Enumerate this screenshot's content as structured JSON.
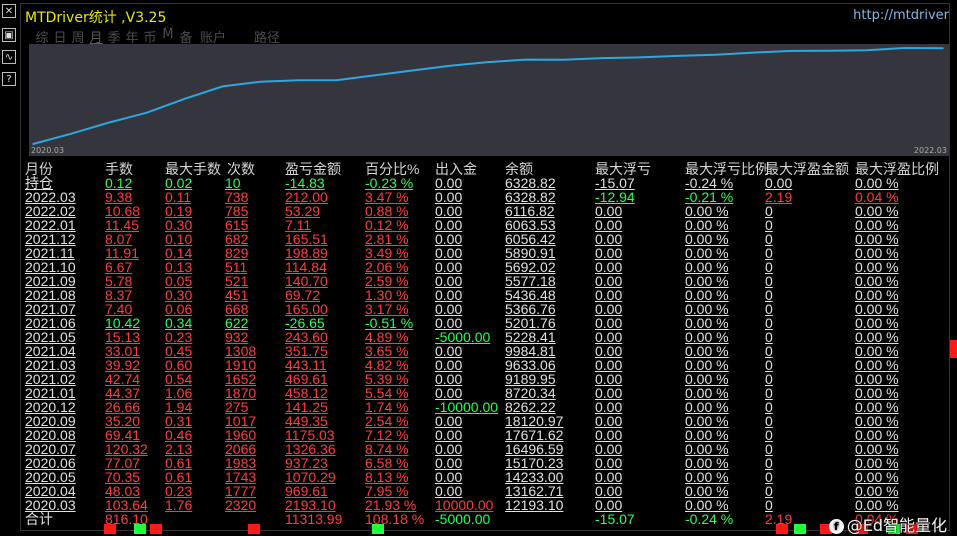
{
  "window": {
    "title": "MTDriver统计 ,V3.25",
    "url_text": "http://mtdriver"
  },
  "tabs": [
    {
      "label": "综",
      "active": false
    },
    {
      "label": "日",
      "active": false
    },
    {
      "label": "周",
      "active": false
    },
    {
      "label": "月",
      "active": true
    },
    {
      "label": "季",
      "active": false
    },
    {
      "label": "年",
      "active": false
    },
    {
      "label": "币",
      "active": false
    },
    {
      "label": "M",
      "active": false
    },
    {
      "label": "备",
      "active": false
    },
    {
      "label": "账户",
      "active": false
    },
    {
      "label": "路径",
      "active": false
    }
  ],
  "chart_data": {
    "type": "line",
    "x_start_label": "2020.03",
    "x_end_label": "2022.03",
    "x": [
      "2020.03",
      "2020.04",
      "2020.05",
      "2020.06",
      "2020.07",
      "2020.08",
      "2020.09",
      "2020.10",
      "2020.12",
      "2021.01",
      "2021.02",
      "2021.03",
      "2021.04",
      "2021.05",
      "2021.06",
      "2021.07",
      "2021.08",
      "2021.09",
      "2021.10",
      "2021.11",
      "2021.12",
      "2022.01",
      "2022.02",
      "2022.03",
      "持仓"
    ],
    "series": [
      {
        "values": [
          0,
          969.61,
          2039.9,
          2977.13,
          4303.49,
          5478.8,
          5928.15,
          6069.4,
          6069.4,
          6527.52,
          6997.13,
          7440.24,
          7791.99,
          8035.59,
          8008.94,
          8173.94,
          8243.66,
          8384.36,
          8499.2,
          8698.09,
          8863.6,
          8870.71,
          8924,
          9136,
          9121.17
        ]
      }
    ],
    "line_color": "#2aa9e0",
    "grid": false
  },
  "columns": [
    "月份",
    "手数",
    "最大手数",
    "次数",
    "盈亏金额",
    "百分比%",
    "出入金",
    "余额",
    "最大浮亏",
    "最大浮亏比例",
    "最大浮盈金额",
    "最大浮盈比例"
  ],
  "rows": [
    {
      "month": "持仓",
      "lots": "0.12",
      "maxlots": "0.02",
      "count": "10",
      "pnl": "-14.83",
      "pct": "-0.23 %",
      "io": "0.00",
      "bal": "6328.82",
      "fl": "-15.07",
      "flp": "-0.24 %",
      "fp": "0.00",
      "fpp": "0.00 %",
      "tone": "green"
    },
    {
      "month": "2022.03",
      "lots": "9.38",
      "maxlots": "0.11",
      "count": "738",
      "pnl": "212.00",
      "pct": "3.47 %",
      "io": "0.00",
      "bal": "6328.82",
      "fl": "-12.94",
      "flp": "-0.21 %",
      "fp": "2.19",
      "fpp": "0.04 %",
      "tone": "red",
      "flgreen": true,
      "fpred": true
    },
    {
      "month": "2022.02",
      "lots": "10.68",
      "maxlots": "0.19",
      "count": "785",
      "pnl": "53.29",
      "pct": "0.88 %",
      "io": "0.00",
      "bal": "6116.82",
      "fl": "0.00",
      "flp": "0.00 %",
      "fp": "0",
      "fpp": "0.00 %",
      "tone": "red"
    },
    {
      "month": "2022.01",
      "lots": "11.45",
      "maxlots": "0.30",
      "count": "615",
      "pnl": "7.11",
      "pct": "0.12 %",
      "io": "0.00",
      "bal": "6063.53",
      "fl": "0.00",
      "flp": "0.00 %",
      "fp": "0",
      "fpp": "0.00 %",
      "tone": "red"
    },
    {
      "month": "2021.12",
      "lots": "8.07",
      "maxlots": "0.10",
      "count": "682",
      "pnl": "165.51",
      "pct": "2.81 %",
      "io": "0.00",
      "bal": "6056.42",
      "fl": "0.00",
      "flp": "0.00 %",
      "fp": "0",
      "fpp": "0.00 %",
      "tone": "red"
    },
    {
      "month": "2021.11",
      "lots": "11.91",
      "maxlots": "0.14",
      "count": "829",
      "pnl": "198.89",
      "pct": "3.49 %",
      "io": "0.00",
      "bal": "5890.91",
      "fl": "0.00",
      "flp": "0.00 %",
      "fp": "0",
      "fpp": "0.00 %",
      "tone": "red"
    },
    {
      "month": "2021.10",
      "lots": "6.67",
      "maxlots": "0.13",
      "count": "511",
      "pnl": "114.84",
      "pct": "2.06 %",
      "io": "0.00",
      "bal": "5692.02",
      "fl": "0.00",
      "flp": "0.00 %",
      "fp": "0",
      "fpp": "0.00 %",
      "tone": "red"
    },
    {
      "month": "2021.09",
      "lots": "5.78",
      "maxlots": "0.05",
      "count": "521",
      "pnl": "140.70",
      "pct": "2.59 %",
      "io": "0.00",
      "bal": "5577.18",
      "fl": "0.00",
      "flp": "0.00 %",
      "fp": "0",
      "fpp": "0.00 %",
      "tone": "red"
    },
    {
      "month": "2021.08",
      "lots": "8.37",
      "maxlots": "0.30",
      "count": "451",
      "pnl": "69.72",
      "pct": "1.30 %",
      "io": "0.00",
      "bal": "5436.48",
      "fl": "0.00",
      "flp": "0.00 %",
      "fp": "0",
      "fpp": "0.00 %",
      "tone": "red"
    },
    {
      "month": "2021.07",
      "lots": "7.40",
      "maxlots": "0.06",
      "count": "668",
      "pnl": "165.00",
      "pct": "3.17 %",
      "io": "0.00",
      "bal": "5366.76",
      "fl": "0.00",
      "flp": "0.00 %",
      "fp": "0",
      "fpp": "0.00 %",
      "tone": "red"
    },
    {
      "month": "2021.06",
      "lots": "10.42",
      "maxlots": "0.34",
      "count": "622",
      "pnl": "-26.65",
      "pct": "-0.51 %",
      "io": "0.00",
      "bal": "5201.76",
      "fl": "0.00",
      "flp": "0.00 %",
      "fp": "0",
      "fpp": "0.00 %",
      "tone": "green"
    },
    {
      "month": "2021.05",
      "lots": "15.13",
      "maxlots": "0.23",
      "count": "932",
      "pnl": "243.60",
      "pct": "4.89 %",
      "io": "-5000.00",
      "bal": "5228.41",
      "fl": "0.00",
      "flp": "0.00 %",
      "fp": "0",
      "fpp": "0.00 %",
      "tone": "red",
      "iogreen": true
    },
    {
      "month": "2021.04",
      "lots": "33.01",
      "maxlots": "0.45",
      "count": "1308",
      "pnl": "351.75",
      "pct": "3.65 %",
      "io": "0.00",
      "bal": "9984.81",
      "fl": "0.00",
      "flp": "0.00 %",
      "fp": "0",
      "fpp": "0.00 %",
      "tone": "red"
    },
    {
      "month": "2021.03",
      "lots": "39.92",
      "maxlots": "0.60",
      "count": "1910",
      "pnl": "443.11",
      "pct": "4.82 %",
      "io": "0.00",
      "bal": "9633.06",
      "fl": "0.00",
      "flp": "0.00 %",
      "fp": "0",
      "fpp": "0.00 %",
      "tone": "red"
    },
    {
      "month": "2021.02",
      "lots": "42.74",
      "maxlots": "0.54",
      "count": "1652",
      "pnl": "469.61",
      "pct": "5.39 %",
      "io": "0.00",
      "bal": "9189.95",
      "fl": "0.00",
      "flp": "0.00 %",
      "fp": "0",
      "fpp": "0.00 %",
      "tone": "red"
    },
    {
      "month": "2021.01",
      "lots": "44.37",
      "maxlots": "1.06",
      "count": "1870",
      "pnl": "458.12",
      "pct": "5.54 %",
      "io": "0.00",
      "bal": "8720.34",
      "fl": "0.00",
      "flp": "0.00 %",
      "fp": "0",
      "fpp": "0.00 %",
      "tone": "red"
    },
    {
      "month": "2020.12",
      "lots": "26.66",
      "maxlots": "1.94",
      "count": "275",
      "pnl": "141.25",
      "pct": "1.74 %",
      "io": "-10000.00",
      "bal": "8262.22",
      "fl": "0.00",
      "flp": "0.00 %",
      "fp": "0",
      "fpp": "0.00 %",
      "tone": "red",
      "iogreen": true
    },
    {
      "month": "2020.09",
      "lots": "35.20",
      "maxlots": "0.31",
      "count": "1017",
      "pnl": "449.35",
      "pct": "2.54 %",
      "io": "0.00",
      "bal": "18120.97",
      "fl": "0.00",
      "flp": "0.00 %",
      "fp": "0",
      "fpp": "0.00 %",
      "tone": "red"
    },
    {
      "month": "2020.08",
      "lots": "69.41",
      "maxlots": "0.46",
      "count": "1960",
      "pnl": "1175.03",
      "pct": "7.12 %",
      "io": "0.00",
      "bal": "17671.62",
      "fl": "0.00",
      "flp": "0.00 %",
      "fp": "0",
      "fpp": "0.00 %",
      "tone": "red"
    },
    {
      "month": "2020.07",
      "lots": "120.32",
      "maxlots": "2.13",
      "count": "2066",
      "pnl": "1326.36",
      "pct": "8.74 %",
      "io": "0.00",
      "bal": "16496.59",
      "fl": "0.00",
      "flp": "0.00 %",
      "fp": "0",
      "fpp": "0.00 %",
      "tone": "red"
    },
    {
      "month": "2020.06",
      "lots": "77.07",
      "maxlots": "0.61",
      "count": "1983",
      "pnl": "937.23",
      "pct": "6.58 %",
      "io": "0.00",
      "bal": "15170.23",
      "fl": "0.00",
      "flp": "0.00 %",
      "fp": "0",
      "fpp": "0.00 %",
      "tone": "red"
    },
    {
      "month": "2020.05",
      "lots": "70.35",
      "maxlots": "0.61",
      "count": "1743",
      "pnl": "1070.29",
      "pct": "8.13 %",
      "io": "0.00",
      "bal": "14233.00",
      "fl": "0.00",
      "flp": "0.00 %",
      "fp": "0",
      "fpp": "0.00 %",
      "tone": "red"
    },
    {
      "month": "2020.04",
      "lots": "48.03",
      "maxlots": "0.23",
      "count": "1777",
      "pnl": "969.61",
      "pct": "7.95 %",
      "io": "0.00",
      "bal": "13162.71",
      "fl": "0.00",
      "flp": "0.00 %",
      "fp": "0",
      "fpp": "0.00 %",
      "tone": "red"
    },
    {
      "month": "2020.03",
      "lots": "103.64",
      "maxlots": "1.76",
      "count": "2320",
      "pnl": "2193.10",
      "pct": "21.93 %",
      "io": "10000.00",
      "bal": "12193.10",
      "fl": "0.00",
      "flp": "0.00 %",
      "fp": "0",
      "fpp": "0.00 %",
      "tone": "red",
      "iored": true
    }
  ],
  "total": {
    "month": "合计",
    "lots": "816.10",
    "maxlots": "",
    "count": "",
    "pnl": "11313.99",
    "pct": "108.18 %",
    "io": "-5000.00",
    "bal": "",
    "fl": "-15.07",
    "flp": "-0.24 %",
    "fp": "2.19",
    "fpp": "0.04 %"
  },
  "watermark": {
    "logo": "f",
    "text": "@Ed智能量化"
  },
  "colors": {
    "title": "#e8e800",
    "red": "#ff3b3b",
    "green": "#27ff52",
    "chart_bg": "#35353d",
    "line": "#2aa9e0"
  },
  "left_icons": [
    "close-box-icon",
    "image-icon",
    "wave-icon",
    "question-icon"
  ],
  "bottom_ticks": [
    {
      "c": "#ff1a1a"
    },
    {
      "c": "#1fff3a"
    },
    {
      "c": "#ff1a1a"
    },
    {
      "c": "#ff1a1a"
    },
    {
      "c": "#1fff3a"
    },
    {
      "c": "#ff1a1a"
    },
    {
      "c": "#1fff3a"
    },
    {
      "c": "#ff1a1a"
    },
    {
      "c": "#ff1a1a"
    },
    {
      "c": "#1fff3a"
    },
    {
      "c": "#ff1a1a"
    }
  ]
}
